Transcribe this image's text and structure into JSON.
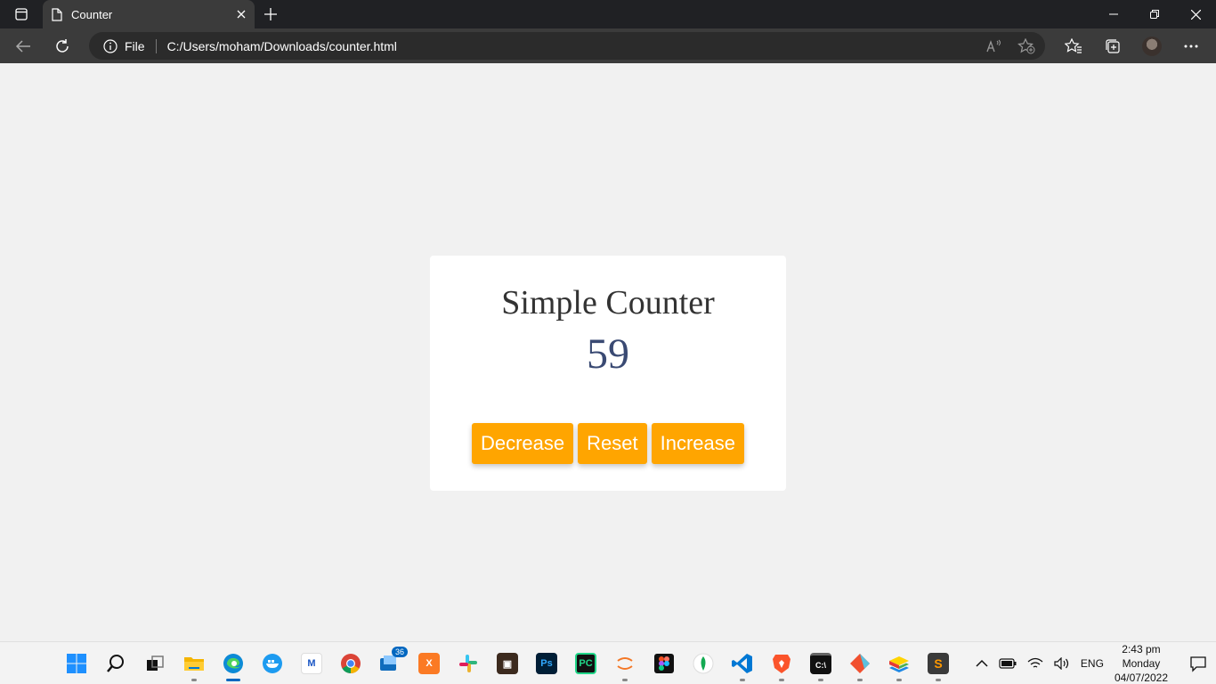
{
  "browser": {
    "tab_title": "Counter",
    "protocol_label": "File",
    "url": "C:/Users/moham/Downloads/counter.html"
  },
  "page": {
    "heading": "Simple Counter",
    "count": "59",
    "buttons": {
      "decrease": "Decrease",
      "reset": "Reset",
      "increase": "Increase"
    },
    "colors": {
      "button_bg": "#ffa500",
      "count_text": "#3a4a73",
      "page_bg": "#f1f1f1"
    }
  },
  "taskbar": {
    "mail_badge": "36",
    "language": "ENG",
    "time": "2:43 pm",
    "day": "Monday",
    "date": "04/07/2022",
    "apps": [
      "start",
      "search",
      "task-view",
      "file-explorer",
      "edge",
      "docker",
      "mongodb-compass",
      "chrome",
      "mail",
      "xampp",
      "slack",
      "virtualbox",
      "photoshop",
      "pycharm",
      "jupyter",
      "figma",
      "mongodb",
      "vscode",
      "brave",
      "terminal",
      "git",
      "bluestacks",
      "sublime-text"
    ]
  }
}
